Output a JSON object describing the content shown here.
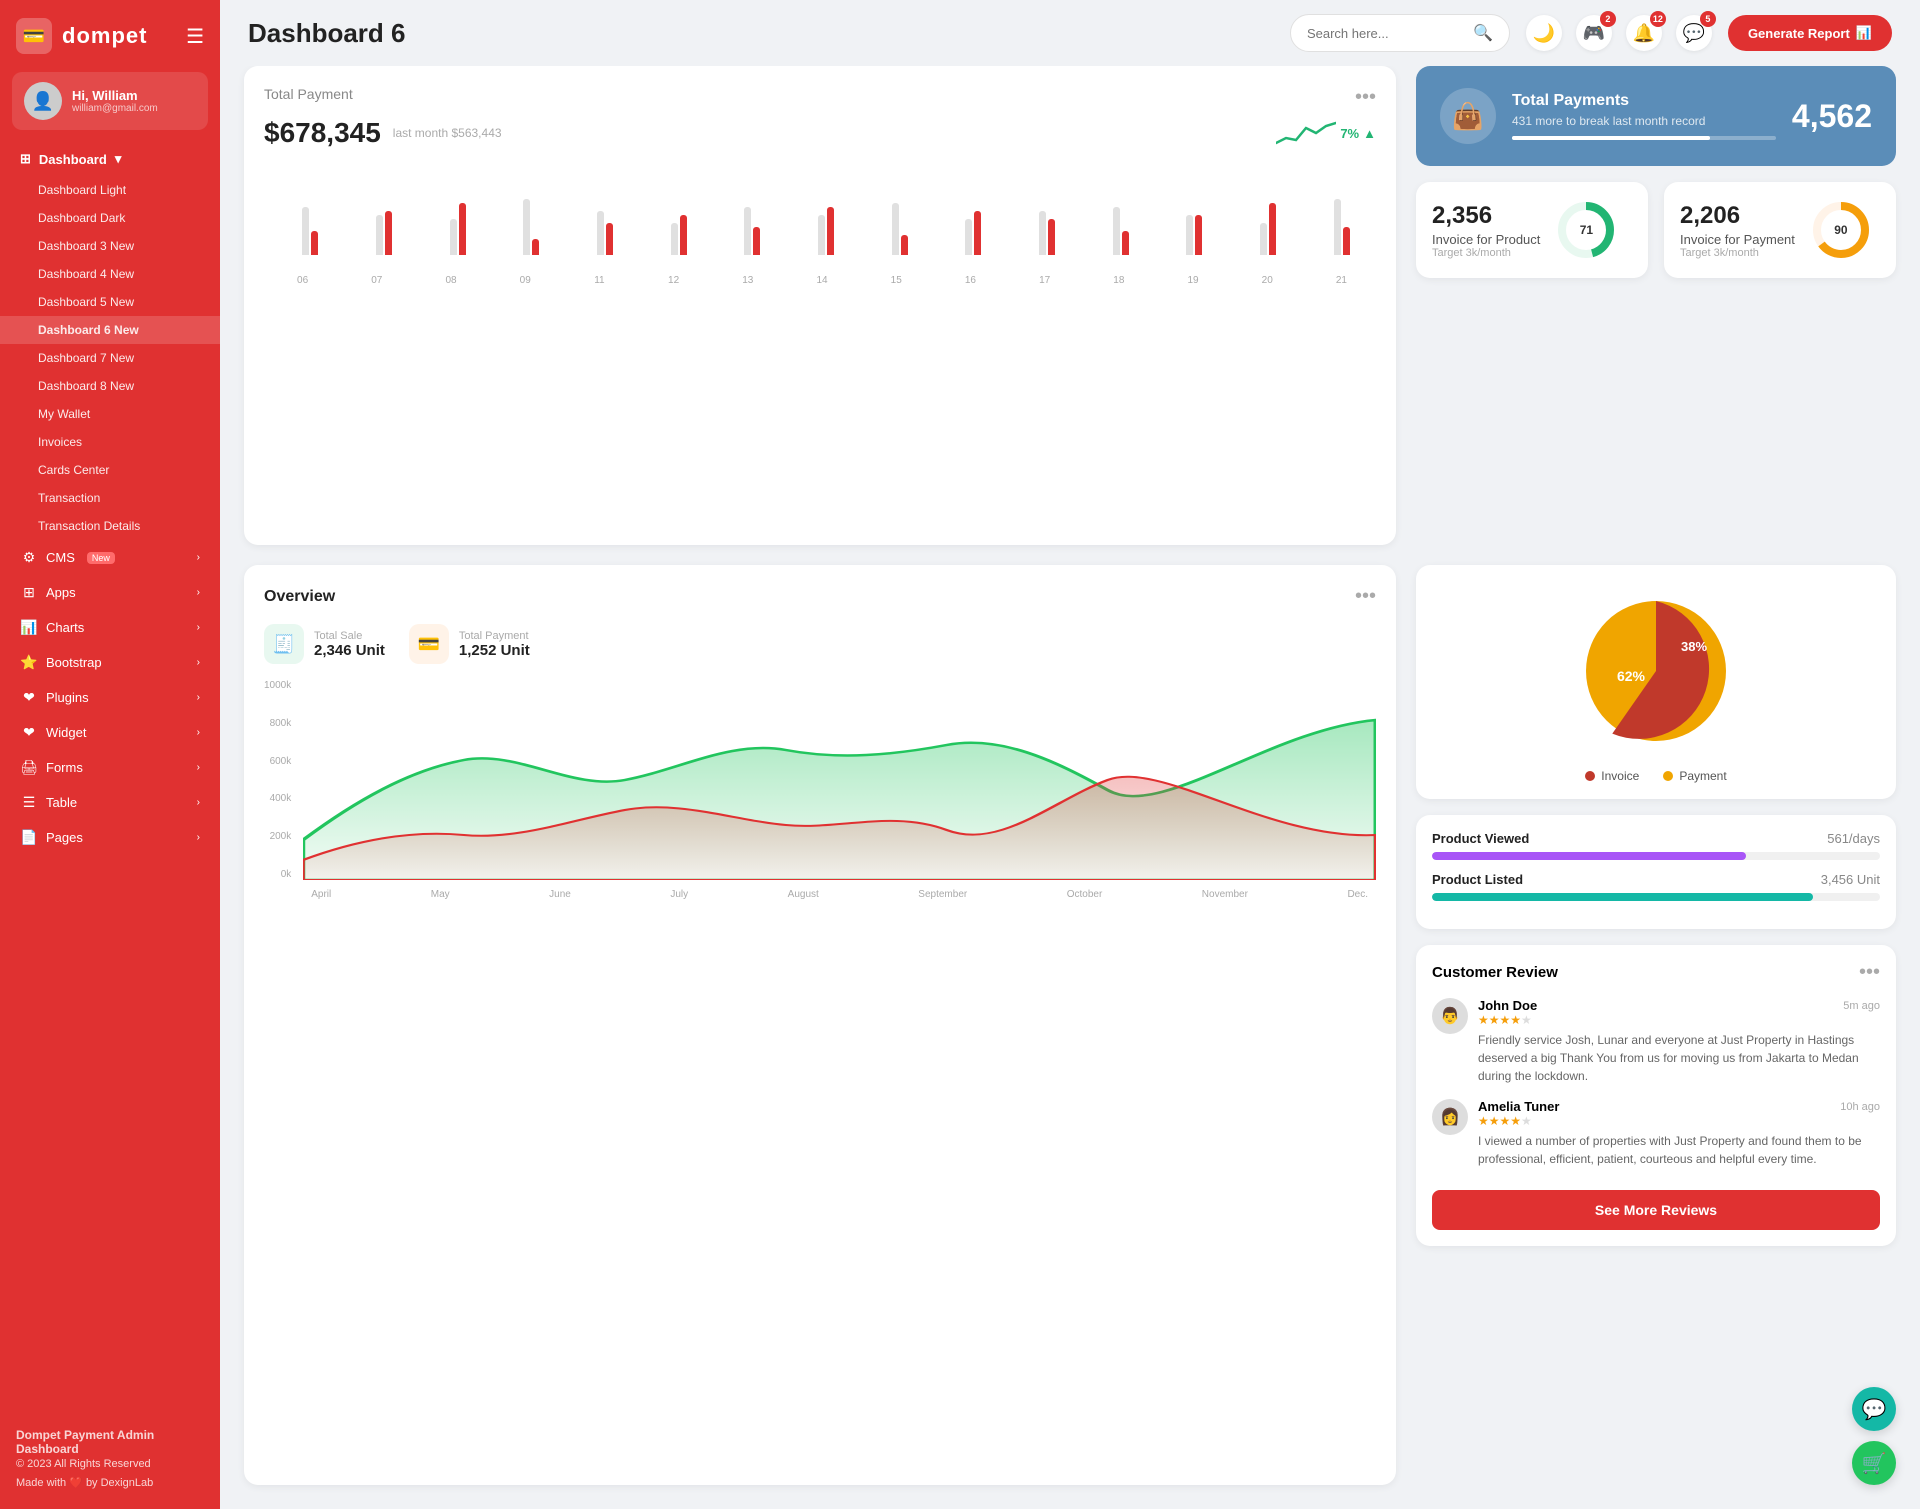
{
  "sidebar": {
    "logo_text": "dompet",
    "hamburger": "☰",
    "user": {
      "greeting": "Hi, William",
      "email": "william@gmail.com",
      "avatar": "👤"
    },
    "dashboard_menu": {
      "label": "Dashboard",
      "items": [
        {
          "label": "Dashboard Light",
          "active": false
        },
        {
          "label": "Dashboard Dark",
          "active": false
        },
        {
          "label": "Dashboard 3",
          "active": false,
          "badge": "New"
        },
        {
          "label": "Dashboard 4",
          "active": false,
          "badge": "New"
        },
        {
          "label": "Dashboard 5",
          "active": false,
          "badge": "New"
        },
        {
          "label": "Dashboard 6",
          "active": true,
          "badge": "New"
        },
        {
          "label": "Dashboard 7",
          "active": false,
          "badge": "New"
        },
        {
          "label": "Dashboard 8",
          "active": false,
          "badge": "New"
        },
        {
          "label": "My Wallet",
          "active": false
        },
        {
          "label": "Invoices",
          "active": false
        },
        {
          "label": "Cards Center",
          "active": false
        },
        {
          "label": "Transaction",
          "active": false
        },
        {
          "label": "Transaction Details",
          "active": false
        }
      ]
    },
    "nav_items": [
      {
        "label": "CMS",
        "badge": "New",
        "icon": "⚙️",
        "has_arrow": true
      },
      {
        "label": "Apps",
        "icon": "🔲",
        "has_arrow": true
      },
      {
        "label": "Charts",
        "icon": "📊",
        "has_arrow": true
      },
      {
        "label": "Bootstrap",
        "icon": "⭐",
        "has_arrow": true
      },
      {
        "label": "Plugins",
        "icon": "❤️",
        "has_arrow": true
      },
      {
        "label": "Widget",
        "icon": "❤️",
        "has_arrow": true
      },
      {
        "label": "Forms",
        "icon": "🖨️",
        "has_arrow": true
      },
      {
        "label": "Table",
        "icon": "☰",
        "has_arrow": true
      },
      {
        "label": "Pages",
        "icon": "📄",
        "has_arrow": true
      }
    ],
    "footer": {
      "brand": "Dompet Payment Admin Dashboard",
      "copy": "© 2023 All Rights Reserved",
      "made": "Made with ❤️ by DexignLab"
    }
  },
  "header": {
    "title": "Dashboard 6",
    "search_placeholder": "Search here...",
    "icons": [
      {
        "name": "moon-icon",
        "symbol": "🌙",
        "badge": null
      },
      {
        "name": "gamepad-icon",
        "symbol": "🎮",
        "badge": "2"
      },
      {
        "name": "bell-icon",
        "symbol": "🔔",
        "badge": "12"
      },
      {
        "name": "chat-icon",
        "symbol": "💬",
        "badge": "5"
      }
    ],
    "generate_btn": "Generate Report"
  },
  "total_payment": {
    "title": "Total Payment",
    "amount": "$678,345",
    "last_month": "last month $563,443",
    "trend": "7%",
    "bars": [
      {
        "label": "06",
        "gray": 60,
        "red": 30
      },
      {
        "label": "07",
        "gray": 50,
        "red": 55
      },
      {
        "label": "08",
        "gray": 45,
        "red": 65
      },
      {
        "label": "09",
        "gray": 70,
        "red": 20
      },
      {
        "label": "11",
        "gray": 55,
        "red": 40
      },
      {
        "label": "12",
        "gray": 40,
        "red": 50
      },
      {
        "label": "13",
        "gray": 60,
        "red": 35
      },
      {
        "label": "14",
        "gray": 50,
        "red": 60
      },
      {
        "label": "15",
        "gray": 65,
        "red": 25
      },
      {
        "label": "16",
        "gray": 45,
        "red": 55
      },
      {
        "label": "17",
        "gray": 55,
        "red": 45
      },
      {
        "label": "18",
        "gray": 60,
        "red": 30
      },
      {
        "label": "19",
        "gray": 50,
        "red": 50
      },
      {
        "label": "20",
        "gray": 40,
        "red": 65
      },
      {
        "label": "21",
        "gray": 70,
        "red": 35
      }
    ]
  },
  "total_payments_blue": {
    "label": "Total Payments",
    "sub": "431 more to break last month record",
    "number": "4,562",
    "progress": 75
  },
  "invoice_product": {
    "number": "2,356",
    "label": "Invoice for Product",
    "target": "Target 3k/month",
    "percent": 71,
    "color": "#22b573"
  },
  "invoice_payment": {
    "number": "2,206",
    "label": "Invoice for Payment",
    "target": "Target 3k/month",
    "percent": 90,
    "color": "#f59e0b"
  },
  "overview": {
    "title": "Overview",
    "total_sale": {
      "label": "Total Sale",
      "value": "2,346 Unit"
    },
    "total_payment": {
      "label": "Total Payment",
      "value": "1,252 Unit"
    },
    "months": [
      "April",
      "May",
      "June",
      "July",
      "August",
      "September",
      "October",
      "November",
      "Dec."
    ],
    "y_labels": [
      "1000k",
      "800k",
      "600k",
      "400k",
      "200k",
      "0k"
    ]
  },
  "pie_chart": {
    "invoice_pct": 62,
    "payment_pct": 38,
    "invoice_color": "#c0392b",
    "payment_color": "#f0a500",
    "legend": [
      {
        "label": "Invoice",
        "color": "#c0392b"
      },
      {
        "label": "Payment",
        "color": "#f0a500"
      }
    ]
  },
  "product_stats": [
    {
      "label": "Product Viewed",
      "value": "561/days",
      "percent": 70,
      "color": "fill-purple"
    },
    {
      "label": "Product Listed",
      "value": "3,456 Unit",
      "percent": 85,
      "color": "fill-teal"
    }
  ],
  "customer_review": {
    "title": "Customer Review",
    "reviews": [
      {
        "name": "John Doe",
        "time": "5m ago",
        "stars": 4,
        "text": "Friendly service Josh, Lunar and everyone at Just Property in Hastings deserved a big Thank You from us for moving us from Jakarta to Medan during the lockdown.",
        "avatar": "👨"
      },
      {
        "name": "Amelia Tuner",
        "time": "10h ago",
        "stars": 4,
        "text": "I viewed a number of properties with Just Property and found them to be professional, efficient, patient, courteous and helpful every time.",
        "avatar": "👩"
      }
    ],
    "btn_more": "See More Reviews"
  },
  "fab": [
    {
      "name": "support-fab",
      "icon": "💬",
      "color": "teal"
    },
    {
      "name": "cart-fab",
      "icon": "🛒",
      "color": "green"
    }
  ]
}
